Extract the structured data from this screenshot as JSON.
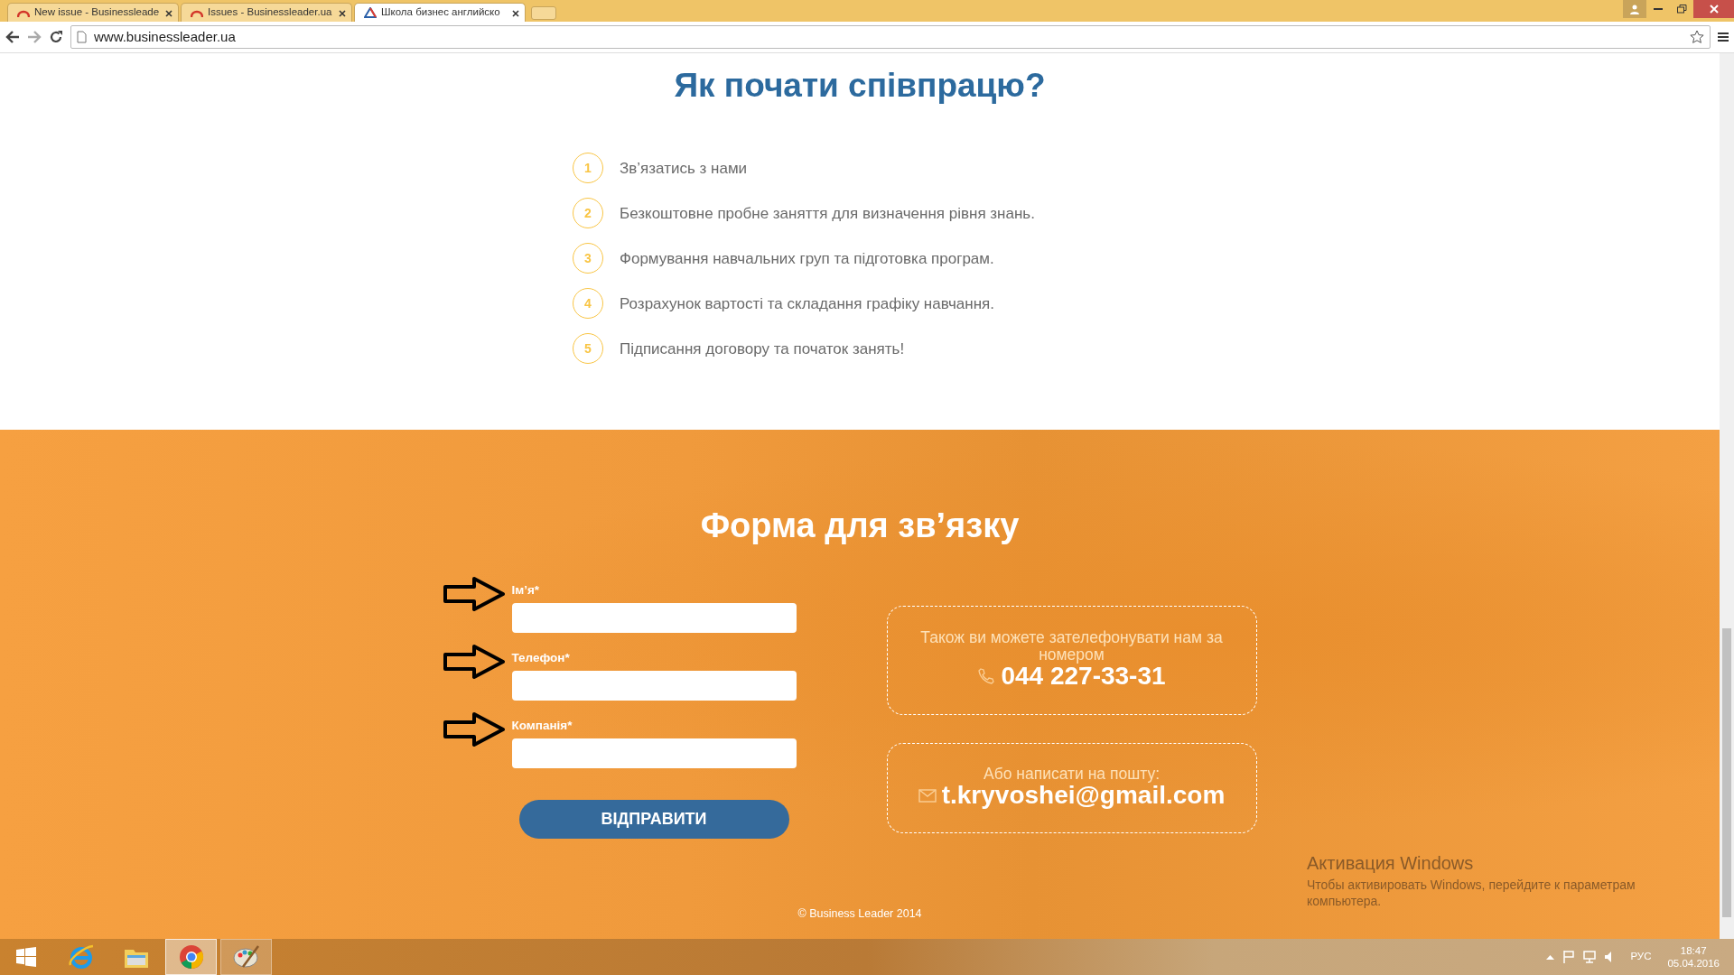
{
  "browser": {
    "tabs": [
      {
        "title": "New issue - Businessleade",
        "selected": false
      },
      {
        "title": "Issues - Businessleader.ua",
        "selected": false
      },
      {
        "title": "Школа бизнес английско",
        "selected": true
      }
    ],
    "url": "www.businessleader.ua"
  },
  "steps_section": {
    "title": "Як почати співпрацю?",
    "steps": [
      {
        "number": "1",
        "text": "Зв’язатись з нами"
      },
      {
        "number": "2",
        "text": "Безкоштовне пробне заняття для визначення рівня знань."
      },
      {
        "number": "3",
        "text": "Формування навчальних груп та підготовка програм."
      },
      {
        "number": "4",
        "text": "Розрахунок вартості та складання графіку навчання."
      },
      {
        "number": "5",
        "text": "Підписання договору та початок занять!"
      }
    ]
  },
  "contact_section": {
    "title": "Форма для зв’язку",
    "fields": [
      {
        "label": "Ім’я*"
      },
      {
        "label": "Телефон*"
      },
      {
        "label": "Компанія*"
      }
    ],
    "submit": "ВІДПРАВИТИ",
    "phone_box": {
      "text": "Також ви можете зателефонувати нам за номером",
      "phone": "044 227-33-31"
    },
    "email_box": {
      "text": "Або написати на пошту:",
      "email": "t.kryvoshei@gmail.com"
    },
    "footer": "© Business Leader 2014"
  },
  "activation_notice": {
    "title": "Активация Windows",
    "text": "Чтобы активировать Windows, перейдите к параметрам компьютера."
  },
  "taskbar": {
    "apps": [
      {
        "kind": "ie",
        "running": false,
        "selected": false
      },
      {
        "kind": "explorer",
        "running": false,
        "selected": false
      },
      {
        "kind": "chrome",
        "running": true,
        "selected": true
      },
      {
        "kind": "paint",
        "running": true,
        "selected": false
      }
    ],
    "language": "РУС",
    "time": "18:47",
    "date": "05.04.2016"
  }
}
